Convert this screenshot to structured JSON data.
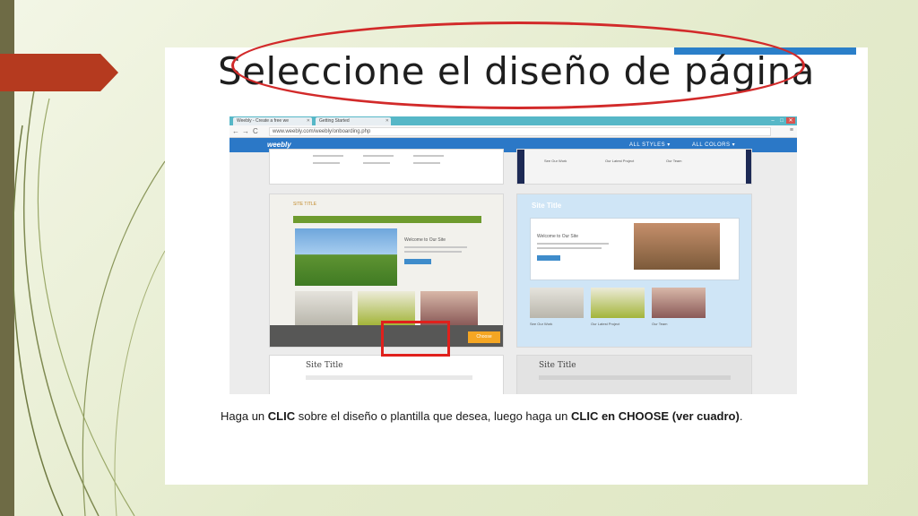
{
  "slide": {
    "heading": "Seleccione el diseño de página",
    "instruction": {
      "part1": "Haga un ",
      "bold1": "CLIC",
      "part2": " sobre el diseño o plantilla que desea, luego haga un ",
      "bold2": "CLIC en CHOOSE (ver cuadro)",
      "part3": "."
    }
  },
  "browser": {
    "tabs": [
      {
        "label": "Weebly - Create a free we"
      },
      {
        "label": "Getting Started"
      }
    ],
    "url": "www.weebly.com/weebly/onboarding.php",
    "logo": "weebly",
    "filters": [
      "ALL STYLES",
      "ALL COLORS"
    ]
  },
  "templates": {
    "left_title": "SITE TITLE",
    "left_welcome": "Welcome to Our Site",
    "right_title": "Site Title",
    "right_welcome": "Welcome to Our Site",
    "right_captions": [
      "See Our Work",
      "Our Latest Project",
      "Our Team"
    ],
    "top_right_captions": [
      "See Our Work",
      "Our Latest Project",
      "Our Team"
    ],
    "bottom_left_title": "Site Title",
    "bottom_right_title": "Site Title",
    "choose_label": "Choose"
  },
  "colors": {
    "accent_red": "#b53a1f",
    "highlight_red": "#e0201c",
    "weebly_blue": "#2b78c7",
    "choose_orange": "#f5a623"
  }
}
